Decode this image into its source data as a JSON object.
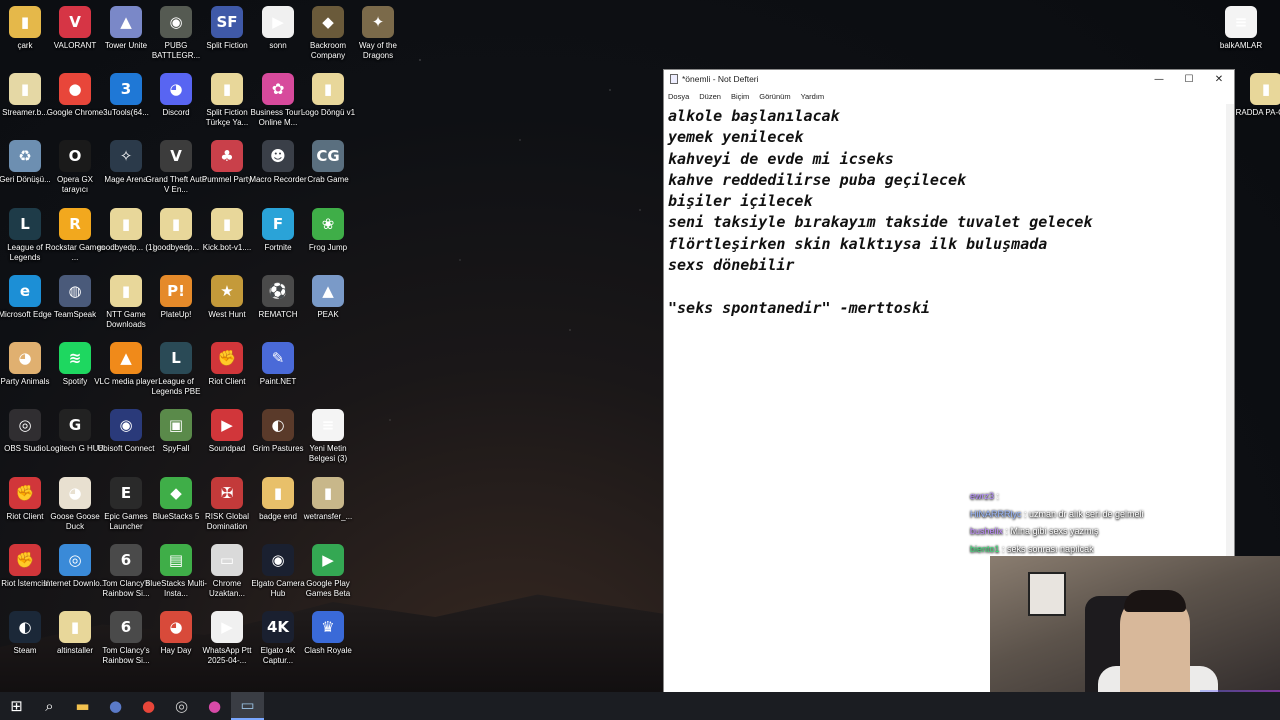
{
  "desktop": {
    "icons": [
      {
        "id": "cark",
        "label": "çark",
        "glyph": "▮",
        "color": "#e5b84a"
      },
      {
        "id": "valorant",
        "label": "VALORANT",
        "glyph": "V",
        "color": "#d63545"
      },
      {
        "id": "tower-unite",
        "label": "Tower Unite",
        "glyph": "▲",
        "color": "#7a88c8"
      },
      {
        "id": "pubg",
        "label": "PUBG BATTLEGR...",
        "glyph": "◉",
        "color": "#555a52"
      },
      {
        "id": "split-fiction",
        "label": "Split Fiction",
        "glyph": "SF",
        "color": "#3f59a8"
      },
      {
        "id": "sonn",
        "label": "sonn",
        "glyph": "▶",
        "color": "#f0f0f0"
      },
      {
        "id": "backroom",
        "label": "Backroom Company",
        "glyph": "◆",
        "color": "#6a5a3a"
      },
      {
        "id": "way-of-dragons",
        "label": "Way of the Dragons",
        "glyph": "✦",
        "color": "#7b6a4a"
      },
      {
        "id": "streamer",
        "label": "Streamer.b...",
        "glyph": "▮",
        "color": "#e5d8a5"
      },
      {
        "id": "chrome",
        "label": "Google Chrome",
        "glyph": "●",
        "color": "#e8463a"
      },
      {
        "id": "3utools",
        "label": "3uTools(64...",
        "glyph": "3",
        "color": "#1f78d6"
      },
      {
        "id": "discord",
        "label": "Discord",
        "glyph": "◕",
        "color": "#5865f2"
      },
      {
        "id": "split-fiction-tr",
        "label": "Split Fiction Türkçe Ya...",
        "glyph": "▮",
        "color": "#e8d79a"
      },
      {
        "id": "business-tour",
        "label": "Business Tour - Online M...",
        "glyph": "✿",
        "color": "#d74a9c"
      },
      {
        "id": "logo-dongu",
        "label": "Logo Döngü v1",
        "glyph": "▮",
        "color": "#e8d79a"
      },
      {
        "id": "recycle",
        "label": "Geri Dönüşü...",
        "glyph": "♻",
        "color": "#6d8fb1"
      },
      {
        "id": "opera-gx",
        "label": "Opera GX tarayıcı",
        "glyph": "O",
        "color": "#1a1a1a"
      },
      {
        "id": "mage-arena",
        "label": "Mage Arena",
        "glyph": "✧",
        "color": "#2b3a4a"
      },
      {
        "id": "gta5",
        "label": "Grand Theft Auto V En...",
        "glyph": "V",
        "color": "#3c3c3c"
      },
      {
        "id": "pummel",
        "label": "Pummel Party",
        "glyph": "♣",
        "color": "#c9404a"
      },
      {
        "id": "macro-recorder",
        "label": "Macro Recorder",
        "glyph": "☻",
        "color": "#3a3f48"
      },
      {
        "id": "crab-game",
        "label": "Crab Game",
        "glyph": "CG",
        "color": "#5a6f7f"
      },
      {
        "id": "lol",
        "label": "League of Legends",
        "glyph": "L",
        "color": "#1e3b48"
      },
      {
        "id": "rockstar",
        "label": "Rockstar Games ...",
        "glyph": "R",
        "color": "#f2a81e"
      },
      {
        "id": "goodbyedp1",
        "label": "goodbyedp... (1)",
        "glyph": "▮",
        "color": "#e8d79a"
      },
      {
        "id": "goodbyedp",
        "label": "goodbyedp...",
        "glyph": "▮",
        "color": "#e8d79a"
      },
      {
        "id": "kickbot",
        "label": "Kick.bot-v1....",
        "glyph": "▮",
        "color": "#e8d79a"
      },
      {
        "id": "fortnite",
        "label": "Fortnite",
        "glyph": "F",
        "color": "#2aa3d8"
      },
      {
        "id": "frog-jump",
        "label": "Frog Jump",
        "glyph": "❀",
        "color": "#3fae48"
      },
      {
        "id": "edge",
        "label": "Microsoft Edge",
        "glyph": "e",
        "color": "#1c8fd6"
      },
      {
        "id": "teamspeak",
        "label": "TeamSpeak",
        "glyph": "◍",
        "color": "#4a5a7a"
      },
      {
        "id": "ntt",
        "label": "NTT Game Downloads",
        "glyph": "▮",
        "color": "#e8d79a"
      },
      {
        "id": "plateup",
        "label": "PlateUp!",
        "glyph": "P!",
        "color": "#e58a2a"
      },
      {
        "id": "west-hunt",
        "label": "West Hunt",
        "glyph": "★",
        "color": "#c49a3a"
      },
      {
        "id": "rematch",
        "label": "REMATCH",
        "glyph": "⚽",
        "color": "#4a4a4a"
      },
      {
        "id": "peak",
        "label": "PEAK",
        "glyph": "▲",
        "color": "#7a9ac8"
      },
      {
        "id": "party-animals",
        "label": "Party Animals",
        "glyph": "◕",
        "color": "#e0b070"
      },
      {
        "id": "spotify",
        "label": "Spotify",
        "glyph": "≋",
        "color": "#1ed760"
      },
      {
        "id": "vlc",
        "label": "VLC media player",
        "glyph": "▲",
        "color": "#f08a1a"
      },
      {
        "id": "lol-pbe",
        "label": "League of Legends PBE",
        "glyph": "L",
        "color": "#2a4a56"
      },
      {
        "id": "riot-client",
        "label": "Riot Client",
        "glyph": "✊",
        "color": "#d1363a"
      },
      {
        "id": "paintnet",
        "label": "Paint.NET",
        "glyph": "✎",
        "color": "#4a6ad8"
      },
      {
        "id": "obs",
        "label": "OBS Studio",
        "glyph": "◎",
        "color": "#302e31"
      },
      {
        "id": "logitech",
        "label": "Logitech G HUB",
        "glyph": "G",
        "color": "#222222"
      },
      {
        "id": "ubisoft",
        "label": "Ubisoft Connect",
        "glyph": "◉",
        "color": "#2a3a7a"
      },
      {
        "id": "spyfall",
        "label": "SpyFall",
        "glyph": "▣",
        "color": "#5a8a4a"
      },
      {
        "id": "soundpad",
        "label": "Soundpad",
        "glyph": "▶",
        "color": "#d1363a"
      },
      {
        "id": "grim",
        "label": "Grim Pastures",
        "glyph": "◐",
        "color": "#5a3a2a"
      },
      {
        "id": "yeni-metin",
        "label": "Yeni Metin Belgesi (3)",
        "glyph": "≡",
        "color": "#f4f4f4"
      },
      {
        "id": "riot-client-2",
        "label": "Riot Client",
        "glyph": "✊",
        "color": "#d1363a"
      },
      {
        "id": "goose",
        "label": "Goose Goose Duck",
        "glyph": "◕",
        "color": "#e8e0d0"
      },
      {
        "id": "epic",
        "label": "Epic Games Launcher",
        "glyph": "E",
        "color": "#2a2a2a"
      },
      {
        "id": "bluestacks",
        "label": "BlueStacks 5",
        "glyph": "◆",
        "color": "#3fae48"
      },
      {
        "id": "risk",
        "label": "RISK Global Domination",
        "glyph": "✠",
        "color": "#c33a3a"
      },
      {
        "id": "badge-end",
        "label": "badge end",
        "glyph": "▮",
        "color": "#e8c06a"
      },
      {
        "id": "wetransfer",
        "label": "wetransfer_...",
        "glyph": "▮",
        "color": "#c8b78a"
      },
      {
        "id": "riot-istemcisi",
        "label": "Riot İstemcisi",
        "glyph": "✊",
        "color": "#d1363a"
      },
      {
        "id": "idm",
        "label": "Internet Downlo...",
        "glyph": "◎",
        "color": "#3a8ad8"
      },
      {
        "id": "r6",
        "label": "Tom Clancy's Rainbow Si...",
        "glyph": "6",
        "color": "#4a4a4a"
      },
      {
        "id": "bluestacks-mi",
        "label": "BlueStacks Multi-Insta...",
        "glyph": "▤",
        "color": "#3fae48"
      },
      {
        "id": "chrome-remote",
        "label": "Chrome Uzaktan...",
        "glyph": "▭",
        "color": "#dadada"
      },
      {
        "id": "elgato-cam",
        "label": "Elgato Camera Hub",
        "glyph": "◉",
        "color": "#1a2030"
      },
      {
        "id": "google-play",
        "label": "Google Play Games Beta",
        "glyph": "▶",
        "color": "#34a853"
      },
      {
        "id": "steam",
        "label": "Steam",
        "glyph": "◐",
        "color": "#1b2838"
      },
      {
        "id": "altinstaller",
        "label": "altinstaller",
        "glyph": "▮",
        "color": "#e8d79a"
      },
      {
        "id": "r6-2",
        "label": "Tom Clancy's Rainbow Si...",
        "glyph": "6",
        "color": "#4a4a4a"
      },
      {
        "id": "hay-day",
        "label": "Hay Day",
        "glyph": "◕",
        "color": "#d84a3a"
      },
      {
        "id": "whatsapp",
        "label": "WhatsApp Ptt 2025-04-...",
        "glyph": "▶",
        "color": "#f0f0f0"
      },
      {
        "id": "elgato-4k",
        "label": "Elgato 4K Captur...",
        "glyph": "4K",
        "color": "#1a2030"
      },
      {
        "id": "clash-royale",
        "label": "Clash Royale",
        "glyph": "♛",
        "color": "#3a6ad8"
      },
      {
        "id": "balkamlar",
        "label": "balkAMLAR",
        "glyph": "≡",
        "color": "#f4f4f4"
      },
      {
        "id": "radda",
        "label": "RADDA PA-GE...",
        "glyph": "▮",
        "color": "#e8d79a"
      }
    ]
  },
  "notepad": {
    "title": "*önemli - Not Defteri",
    "menu": [
      "Dosya",
      "Düzen",
      "Biçim",
      "Görünüm",
      "Yardım"
    ],
    "controls": {
      "minimize": "—",
      "maximize": "☐",
      "close": "✕"
    },
    "lines": [
      "alkole başlanılacak",
      "yemek yenilecek",
      "kahveyi de evde mi icseks",
      "kahve reddedilirse puba geçilecek",
      "bişiler içilecek",
      "seni taksiyle bırakayım takside tuvalet gelecek",
      "flörtleşirken skin kalktıysa ilk buluşmada",
      "sexs dönebilir",
      "",
      "\"seks spontanedir\" -merttoski"
    ]
  },
  "chat": [
    {
      "user": "ewrz3",
      "text": ":",
      "user_color": "#b58cff"
    },
    {
      "user": "HiNARRRlyc",
      "text": ": uzman dr alık seri de gelmeli",
      "user_color": "#9ab8ff"
    },
    {
      "user": "bushelix",
      "text": ": Mina gibi sexs yazmış",
      "user_color": "#c08cff"
    },
    {
      "user": "biento1",
      "text": ": seks sonrası napılcak",
      "user_color": "#3fe07a"
    }
  ],
  "taskbar": {
    "items": [
      {
        "id": "start",
        "glyph": "⊞",
        "color": "#ffffff"
      },
      {
        "id": "search",
        "glyph": "⌕",
        "color": "#ffffff"
      },
      {
        "id": "explorer",
        "glyph": "▬",
        "color": "#f2c14e"
      },
      {
        "id": "app-1",
        "glyph": "●",
        "color": "#5a7ac8"
      },
      {
        "id": "chrome",
        "glyph": "●",
        "color": "#e8463a"
      },
      {
        "id": "app-2",
        "glyph": "◎",
        "color": "#cccccc"
      },
      {
        "id": "app-3",
        "glyph": "●",
        "color": "#d84aa8"
      },
      {
        "id": "notepad",
        "glyph": "▭",
        "color": "#9ec6e8"
      }
    ]
  }
}
